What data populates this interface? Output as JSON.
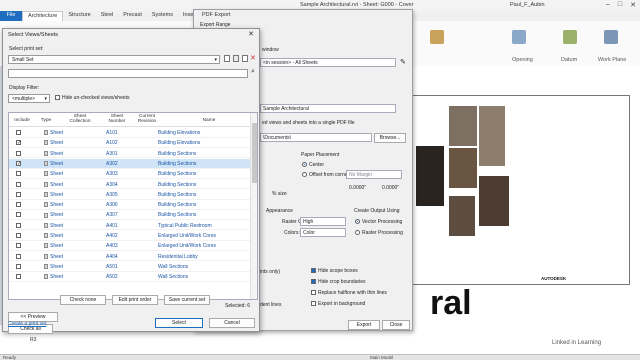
{
  "app": {
    "document_title": "Sample Architectural.rvt - Sheet: G000 - Cover",
    "user": "Paul_F_Aubin",
    "tabs": [
      "File",
      "Architecture",
      "Structure",
      "Steel",
      "Precast",
      "Systems",
      "Insert"
    ],
    "ribbon_labels": [
      "Opening",
      "Datum",
      "Work Plane"
    ],
    "statusbar": "Ready",
    "view_label": "Main Model",
    "watermark": "Linked in Learning"
  },
  "pdf_export": {
    "title": "PDF Export",
    "export_range": "Export Range",
    "window_label": "window",
    "set_value": "<in session> - All Sheets",
    "file_value": "Sample Architectural",
    "combine_label": "ed views and sheets into a single PDF file",
    "folder_value": "\\Documents\\",
    "browse": "Browse...",
    "paper_placement": "Paper Placement",
    "center": "Center",
    "offset": "Offset from corner:",
    "no_margin": "No Margin",
    "offset_x": "0.0000\"",
    "offset_y": "0.0000\"",
    "size_label": "% size",
    "appearance": "Appearance",
    "raster_quality_label": "Raster Quality:",
    "raster_quality": "High",
    "colors_label": "Colors:",
    "colors": "Color",
    "create_output": "Create Output Using",
    "vector": "Vector Processing",
    "raster": "Raster Processing",
    "opt_left1": "ints only)",
    "opt_left2": "dent lines",
    "hide_scope": "Hide scope boxes",
    "hide_crop": "Hide crop boundaries",
    "replace_halftone": "Replace halftone with thin lines",
    "export_bg": "Export in background",
    "export_btn": "Export",
    "close_btn": "Close"
  },
  "select_dialog": {
    "title": "Select Views/Sheets",
    "close_icon": "close-icon",
    "print_set_label": "Select print set:",
    "print_set_value": "Small Set",
    "display_filter_label": "Display Filter:",
    "filter_value": "<multiple>",
    "hide_unchecked": "Hide un-checked views/sheets",
    "columns": {
      "include": "Include",
      "type": "Type",
      "collection": "Sheet Collection",
      "number": "Sheet Number",
      "revision": "Current Revision",
      "name": "Name"
    },
    "rows": [
      {
        "checked": false,
        "type": "Sheet",
        "number": "A101",
        "name": "Building Elevations"
      },
      {
        "checked": true,
        "type": "Sheet",
        "number": "A102",
        "name": "Building Elevations"
      },
      {
        "checked": false,
        "type": "Sheet",
        "number": "A301",
        "name": "Building Sections"
      },
      {
        "checked": true,
        "type": "Sheet",
        "number": "A302",
        "name": "Building Sections"
      },
      {
        "checked": false,
        "type": "Sheet",
        "number": "A303",
        "name": "Building Sections"
      },
      {
        "checked": false,
        "type": "Sheet",
        "number": "A304",
        "name": "Building Sections"
      },
      {
        "checked": false,
        "type": "Sheet",
        "number": "A305",
        "name": "Building Sections"
      },
      {
        "checked": false,
        "type": "Sheet",
        "number": "A306",
        "name": "Building Sections"
      },
      {
        "checked": false,
        "type": "Sheet",
        "number": "A307",
        "name": "Building Sections"
      },
      {
        "checked": false,
        "type": "Sheet",
        "number": "A401",
        "name": "Typical Public Restroom"
      },
      {
        "checked": false,
        "type": "Sheet",
        "number": "A402",
        "name": "Enlarged Unit/Work Cores"
      },
      {
        "checked": false,
        "type": "Sheet",
        "number": "A403",
        "name": "Enlarged Unit/Work Cores"
      },
      {
        "checked": false,
        "type": "Sheet",
        "number": "A404",
        "name": "Residential Lobby"
      },
      {
        "checked": false,
        "type": "Sheet",
        "number": "A501",
        "name": "Wall Sections"
      },
      {
        "checked": false,
        "type": "Sheet",
        "number": "A502",
        "name": "Wall Sections"
      }
    ],
    "selected_count": "Selected: 6",
    "preview": "<< Preview",
    "check_all": "Check all",
    "check_none": "Check none",
    "edit_print_order": "Edit print order",
    "save_current_set": "Save current set",
    "create_print_set": "Create a print set",
    "select": "Select",
    "cancel": "Cancel"
  },
  "sheet": {
    "big_text": "ral",
    "logo": "AUTODESK",
    "project_browser_item": "R3"
  },
  "colors": {
    "accent": "#1e6dbf",
    "selection": "#cfe4f7"
  }
}
